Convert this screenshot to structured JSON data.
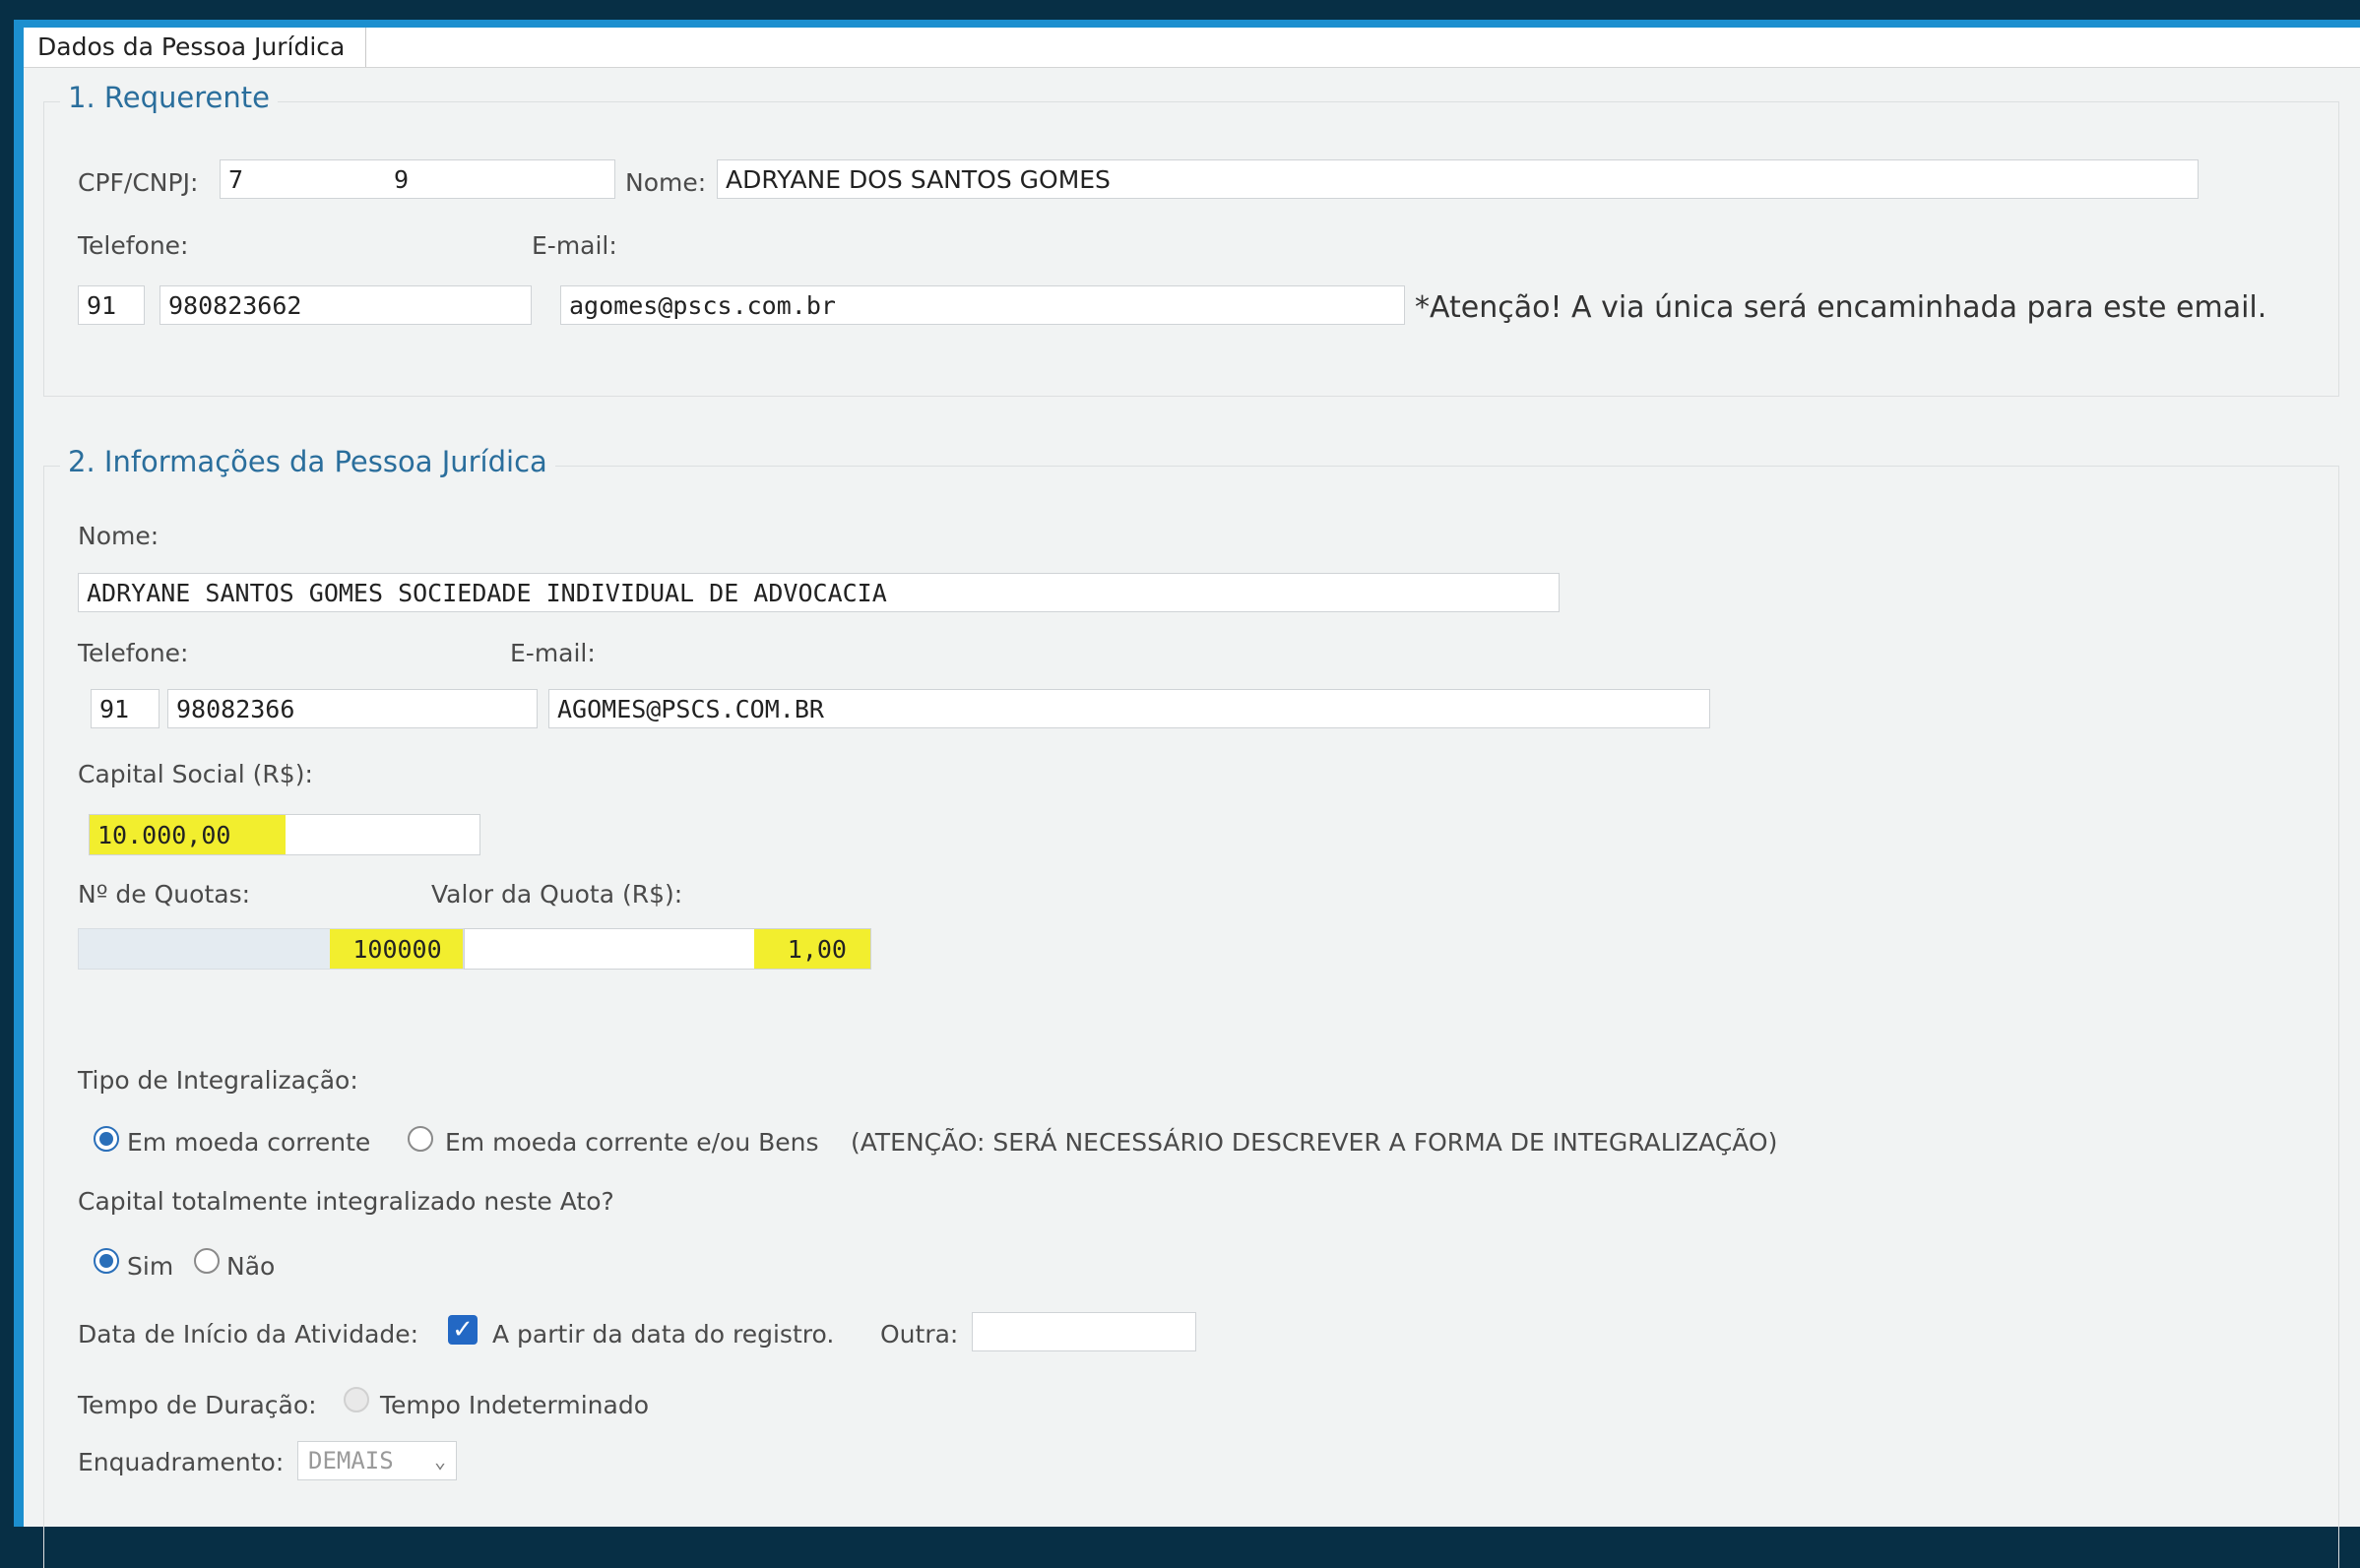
{
  "tab": {
    "label": "Dados da Pessoa Jurídica"
  },
  "requerente": {
    "legend": "1. Requerente",
    "cpf_label": "CPF/CNPJ:",
    "cpf_value_start": "7",
    "cpf_value_end": "9",
    "nome_label": "Nome:",
    "nome_value": "ADRYANE DOS SANTOS GOMES",
    "telefone_label": "Telefone:",
    "email_label": "E-mail:",
    "ddd": "91",
    "telefone": "980823662",
    "email": "agomes@pscs.com.br",
    "notice": "*Atenção! A via única será encaminhada para este email."
  },
  "pj": {
    "legend": "2. Informações da Pessoa Jurídica",
    "nome_label": "Nome:",
    "nome_value": "ADRYANE  SANTOS GOMES SOCIEDADE INDIVIDUAL DE ADVOCACIA",
    "telefone_label": "Telefone:",
    "email_label": "E-mail:",
    "ddd": "91",
    "telefone": "98082366",
    "email": "AGOMES@PSCS.COM.BR",
    "capital_label": "Capital Social (R$):",
    "capital_value": "10.000,00",
    "quotas_label": "Nº de Quotas:",
    "quotas_value": "100000",
    "valor_quota_label": "Valor da Quota (R$):",
    "valor_quota_value": "1,00",
    "tipo_label": "Tipo de Integralização:",
    "tipo_opt1": "Em moeda corrente",
    "tipo_opt2": "Em moeda corrente e/ou Bens",
    "tipo_note": "(ATENÇÃO: SERÁ NECESSÁRIO DESCREVER A FORMA DE INTEGRALIZAÇÃO)",
    "capital_total_label": "Capital totalmente integralizado neste Ato?",
    "sim": "Sim",
    "nao": "Não",
    "data_inicio_label": "Data de Início da Atividade:",
    "data_inicio_check_label": "A partir da data do registro.",
    "outra_label": "Outra:",
    "outra_value": "",
    "duracao_label": "Tempo de Duração:",
    "duracao_option": "Tempo Indeterminado",
    "enquadramento_label": "Enquadramento:",
    "enquadramento_value": "DEMAIS"
  },
  "colors": {
    "accent": "#1c8fcf",
    "highlight": "#f2ee2e",
    "legend": "#2a6e9c"
  }
}
